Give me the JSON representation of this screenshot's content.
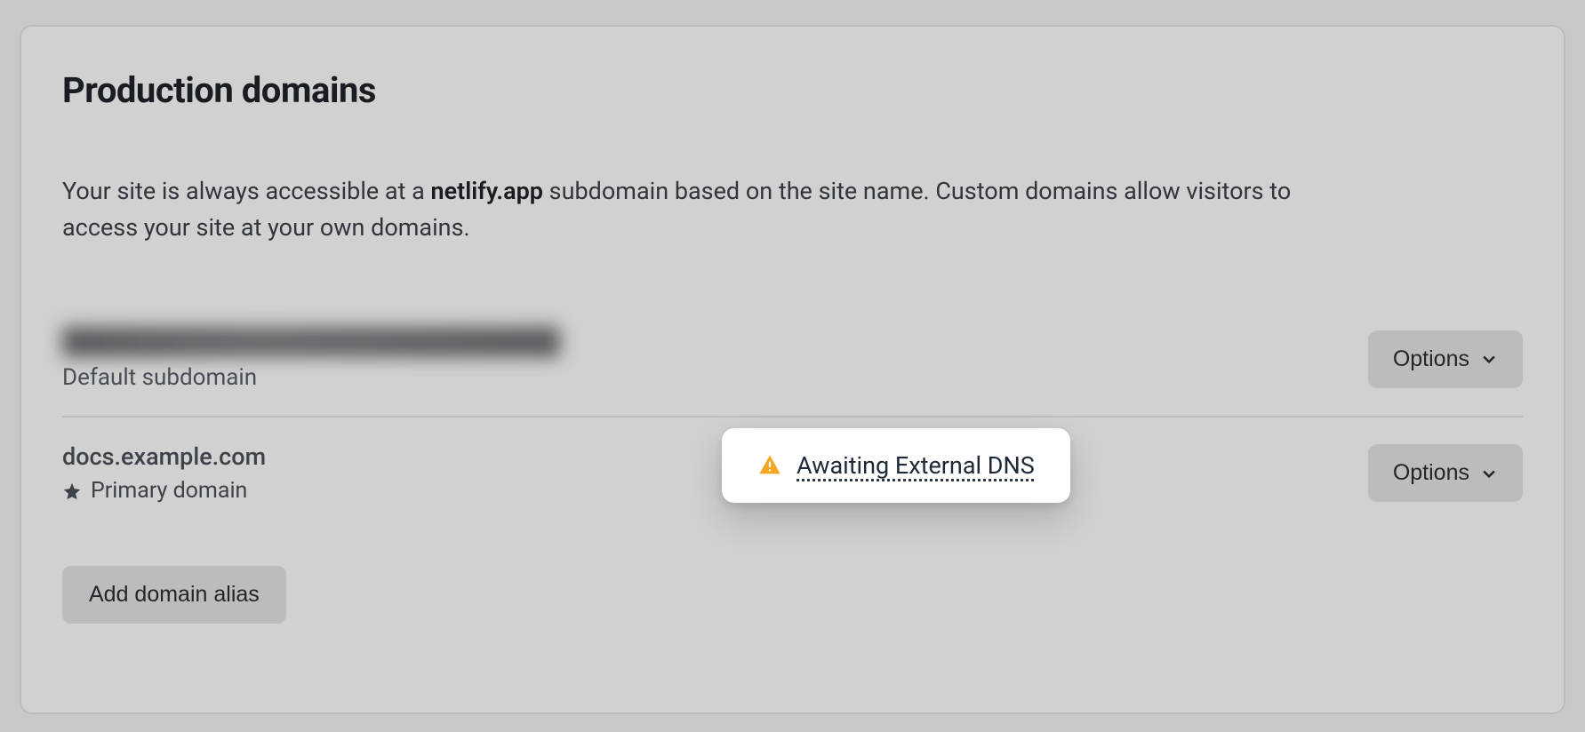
{
  "header": {
    "title": "Production domains"
  },
  "description": {
    "part1": "Your site is always accessible at a ",
    "bold": "netlify.app",
    "part2": " subdomain based on the site name. Custom domains allow visitors to access your site at your own domains."
  },
  "domains": [
    {
      "name_redacted": true,
      "subtext": "Default subdomain",
      "options_label": "Options"
    },
    {
      "name": "docs.example.com",
      "primary_label": "Primary domain",
      "status_text": "Awaiting External DNS",
      "options_label": "Options"
    }
  ],
  "actions": {
    "add_alias": "Add domain alias"
  }
}
